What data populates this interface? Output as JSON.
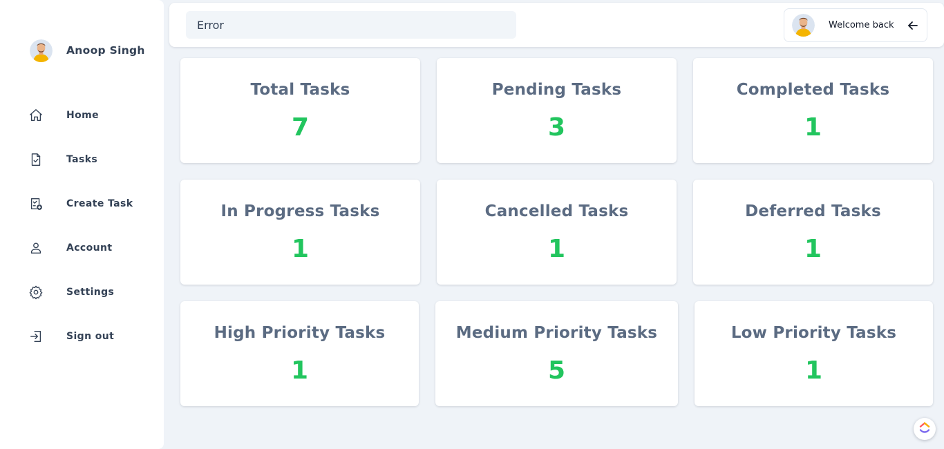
{
  "user": {
    "name": "Anoop Singh"
  },
  "sidebar": {
    "items": [
      {
        "label": "Home",
        "icon": "home-icon"
      },
      {
        "label": "Tasks",
        "icon": "document-check-icon"
      },
      {
        "label": "Create Task",
        "icon": "add-document-icon"
      },
      {
        "label": "Account",
        "icon": "user-icon"
      },
      {
        "label": "Settings",
        "icon": "gear-icon"
      },
      {
        "label": "Sign out",
        "icon": "sign-out-icon"
      }
    ]
  },
  "header": {
    "search_value": "Error",
    "welcome_text": "Welcome back"
  },
  "stats": [
    {
      "label": "Total Tasks",
      "value": "7"
    },
    {
      "label": "Pending Tasks",
      "value": "3"
    },
    {
      "label": "Completed Tasks",
      "value": "1"
    },
    {
      "label": "In Progress Tasks",
      "value": "1"
    },
    {
      "label": "Cancelled Tasks",
      "value": "1"
    },
    {
      "label": "Deferred Tasks",
      "value": "1"
    },
    {
      "label": "High Priority Tasks",
      "value": "1"
    },
    {
      "label": "Medium Priority Tasks",
      "value": "5"
    },
    {
      "label": "Low Priority Tasks",
      "value": "1"
    }
  ],
  "colors": {
    "value_green": "#22c55e",
    "title_slate": "#5b6b82",
    "background": "#eff3f8"
  }
}
